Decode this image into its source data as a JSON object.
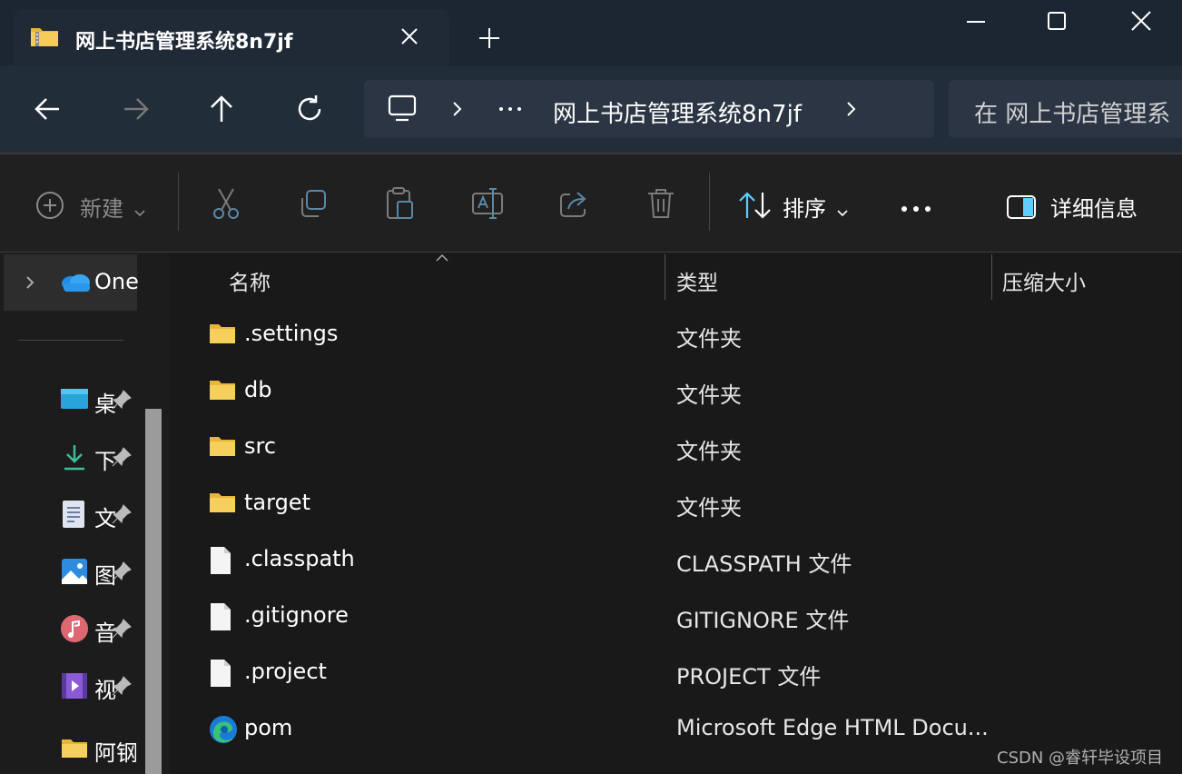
{
  "window": {
    "tab_title": "网上书店管理系统8n7jf",
    "tab_icon": "folder-zip-icon"
  },
  "navigation": {
    "address_text": "网上书店管理系统8n7jf",
    "search_placeholder": "在 网上书店管理系"
  },
  "toolbar": {
    "new_label": "新建",
    "sort_label": "排序",
    "details_label": "详细信息"
  },
  "sidebar": {
    "onedrive_label": "One",
    "items": [
      {
        "label": "桌",
        "icon": "desktop-icon"
      },
      {
        "label": "下",
        "icon": "download-icon"
      },
      {
        "label": "文",
        "icon": "documents-icon"
      },
      {
        "label": "图",
        "icon": "pictures-icon"
      },
      {
        "label": "音",
        "icon": "music-icon"
      },
      {
        "label": "视",
        "icon": "videos-icon"
      },
      {
        "label": "阿钢",
        "icon": "folder-icon"
      }
    ]
  },
  "columns": {
    "name": "名称",
    "type": "类型",
    "size": "压缩大小"
  },
  "files": [
    {
      "name": ".settings",
      "type": "文件夹",
      "icon": "folder"
    },
    {
      "name": "db",
      "type": "文件夹",
      "icon": "folder"
    },
    {
      "name": "src",
      "type": "文件夹",
      "icon": "folder"
    },
    {
      "name": "target",
      "type": "文件夹",
      "icon": "folder"
    },
    {
      "name": ".classpath",
      "type": "CLASSPATH 文件",
      "icon": "file"
    },
    {
      "name": ".gitignore",
      "type": "GITIGNORE 文件",
      "icon": "file"
    },
    {
      "name": ".project",
      "type": "PROJECT 文件",
      "icon": "file"
    },
    {
      "name": "pom",
      "type": "Microsoft Edge HTML Docu...",
      "icon": "edge"
    }
  ],
  "watermark": "CSDN @睿轩毕设项目",
  "colors": {
    "titlebar": "#1c2633",
    "navbar": "#222d3a",
    "folder": "#f2c14e",
    "accent": "#60cdff"
  }
}
